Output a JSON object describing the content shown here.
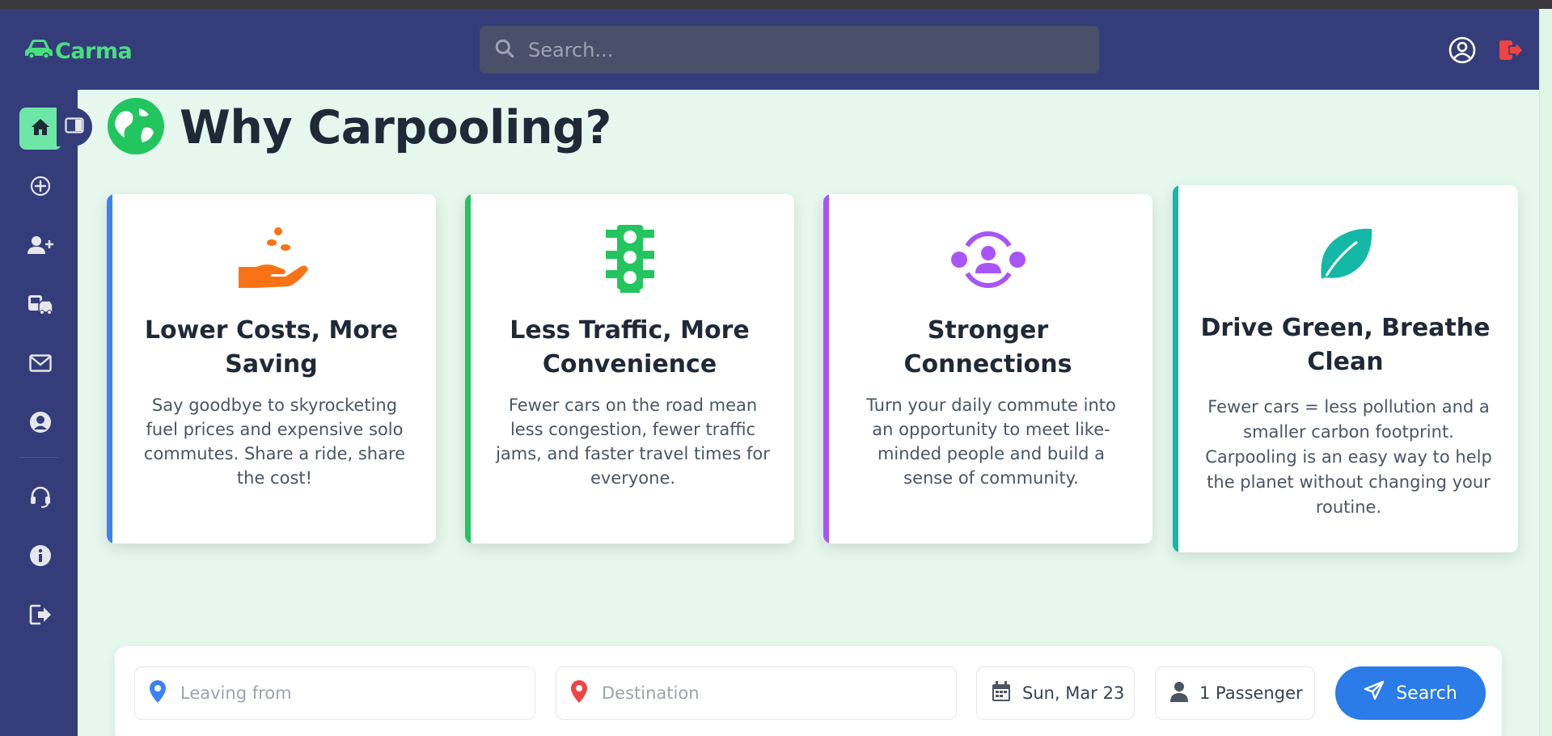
{
  "app": {
    "name": "Carma"
  },
  "header": {
    "search_placeholder": "Search..."
  },
  "sidebar": {
    "items": [
      {
        "name": "home",
        "icon": "home-icon",
        "active": true
      },
      {
        "name": "create-ride",
        "icon": "plus-circle-icon"
      },
      {
        "name": "add-user",
        "icon": "user-plus-icon"
      },
      {
        "name": "vehicles",
        "icon": "car-bus-icon"
      },
      {
        "name": "messages",
        "icon": "envelope-icon"
      },
      {
        "name": "profile",
        "icon": "user-circle-icon"
      },
      {
        "name": "support",
        "icon": "headset-icon"
      },
      {
        "name": "about",
        "icon": "info-circle-icon"
      },
      {
        "name": "logout",
        "icon": "sign-out-icon"
      }
    ]
  },
  "hero": {
    "title": "Why Carpooling?",
    "icon": "globe-icon"
  },
  "cards": [
    {
      "title": "Lower Costs, More Saving",
      "text": "Say goodbye to skyrocketing fuel prices and expensive solo commutes. Share a ride, share the cost!",
      "icon": "hand-coins-icon",
      "accent": "#3b82f6"
    },
    {
      "title": "Less Traffic, More Convenience",
      "text": "Fewer cars on the road mean less congestion, fewer traffic jams, and faster travel times for everyone.",
      "icon": "traffic-light-icon",
      "accent": "#22c55e"
    },
    {
      "title": "Stronger Connections",
      "text": "Turn your daily commute into an opportunity to meet like-minded people and build a sense of community.",
      "icon": "people-group-icon",
      "accent": "#a855f7"
    },
    {
      "title": "Drive Green, Breathe Clean",
      "text": "Fewer cars = less pollution and a smaller carbon footprint. Carpooling is an easy way to help the planet without changing your routine.",
      "icon": "leaf-icon",
      "accent": "#14b8a6"
    }
  ],
  "ride_search": {
    "leaving_placeholder": "Leaving from",
    "destination_placeholder": "Destination",
    "date": "Sun, Mar 23",
    "passengers": "1 Passenger",
    "search_label": "Search"
  },
  "colors": {
    "navbar": "#343d7a",
    "brand_green": "#4ade80",
    "search_button": "#2b7be8",
    "logout_red": "#ef4444"
  }
}
